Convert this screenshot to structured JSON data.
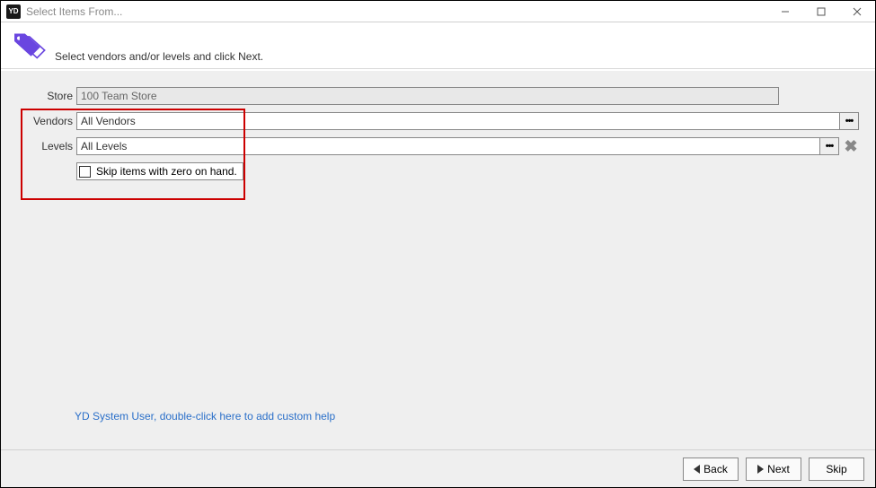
{
  "titlebar": {
    "app_badge": "YD",
    "title": "Select Items From..."
  },
  "header": {
    "instruction": "Select vendors and/or levels and click Next."
  },
  "form": {
    "store": {
      "label": "Store",
      "value": "100 Team Store"
    },
    "vendors": {
      "label": "Vendors",
      "value": "All Vendors"
    },
    "levels": {
      "label": "Levels",
      "value": "All Levels"
    },
    "skip_checkbox_label": "Skip items with zero on hand."
  },
  "help_link": "YD System User, double-click here to add custom help",
  "footer": {
    "back": "Back",
    "next": "Next",
    "skip": "Skip"
  },
  "colors": {
    "highlight": "#c00",
    "accent": "#5a3fd4",
    "link": "#2a6fc9"
  }
}
